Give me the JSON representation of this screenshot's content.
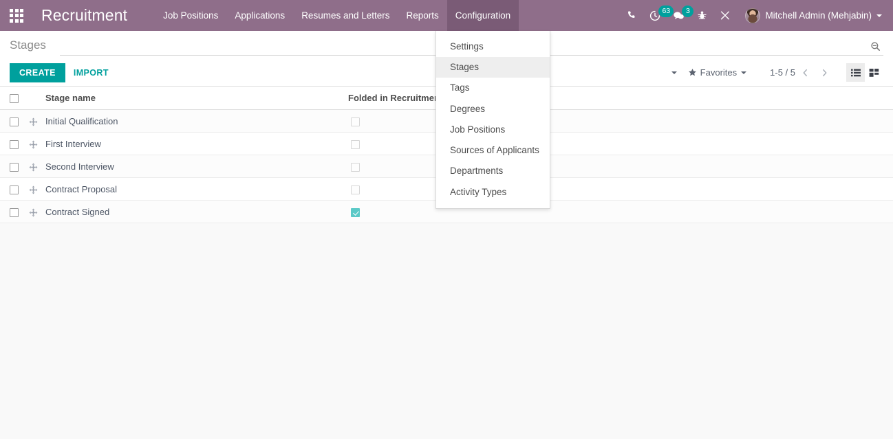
{
  "navbar": {
    "apps_icon": "apps-grid-icon",
    "brand": "Recruitment",
    "menu_items": [
      {
        "label": "Job Positions",
        "active": false
      },
      {
        "label": "Applications",
        "active": false
      },
      {
        "label": "Resumes and Letters",
        "active": false
      },
      {
        "label": "Reports",
        "active": false
      },
      {
        "label": "Configuration",
        "active": true
      }
    ],
    "systray": {
      "phone_icon": "phone-icon",
      "activities_icon": "clock-activities-icon",
      "activities_count": "63",
      "messages_icon": "chat-messages-icon",
      "messages_count": "3",
      "debug_icon": "bug-icon",
      "tools_icon": "wrench-screwdriver-icon",
      "user_avatar": "avatar",
      "user_name": "Mitchell Admin (Mehjabin)",
      "user_caret": "chevron-down-icon"
    }
  },
  "dropdown": {
    "open_for": "Configuration",
    "items": [
      {
        "label": "Settings",
        "focused": false
      },
      {
        "label": "Stages",
        "focused": true
      },
      {
        "label": "Tags",
        "focused": false
      },
      {
        "label": "Degrees",
        "focused": false
      },
      {
        "label": "Job Positions",
        "focused": false
      },
      {
        "label": "Sources of Applicants",
        "focused": false
      },
      {
        "label": "Departments",
        "focused": false
      },
      {
        "label": "Activity Types",
        "focused": false
      }
    ]
  },
  "control_panel": {
    "breadcrumb": "Stages",
    "search": {
      "value": "",
      "placeholder": "",
      "icon": "search-icon"
    },
    "create_label": "Create",
    "import_label": "Import",
    "favorites_label": "Favorites",
    "favorites_icon": "star-icon",
    "pager_value": "1-5 / 5",
    "prev_icon": "chevron-left-icon",
    "next_icon": "chevron-right-icon",
    "views": [
      {
        "name": "list",
        "icon": "list-view-icon",
        "active": true
      },
      {
        "name": "kanban",
        "icon": "kanban-view-icon",
        "active": false
      }
    ]
  },
  "list": {
    "columns": [
      {
        "key": "select_all",
        "label": ""
      },
      {
        "key": "handle",
        "label": ""
      },
      {
        "key": "name",
        "label": "Stage name"
      },
      {
        "key": "folded",
        "label": "Folded in Recruitment Pipe"
      }
    ],
    "select_all_checked": false,
    "rows": [
      {
        "selected": false,
        "handle_icon": "drag-move-icon",
        "name": "Initial Qualification",
        "folded": false
      },
      {
        "selected": false,
        "handle_icon": "drag-move-icon",
        "name": "First Interview",
        "folded": false
      },
      {
        "selected": false,
        "handle_icon": "drag-move-icon",
        "name": "Second Interview",
        "folded": false
      },
      {
        "selected": false,
        "handle_icon": "drag-move-icon",
        "name": "Contract Proposal",
        "folded": false
      },
      {
        "selected": false,
        "handle_icon": "drag-move-icon",
        "name": "Contract Signed",
        "folded": true
      }
    ]
  },
  "colors": {
    "navbar_bg": "#8f6e8a",
    "navbar_active_bg": "#7a5b76",
    "accent_teal": "#00a09d",
    "badge_teal": "#00a09d",
    "checkbox_checked": "#5bc9c7",
    "page_bg": "#f9f9f9"
  }
}
